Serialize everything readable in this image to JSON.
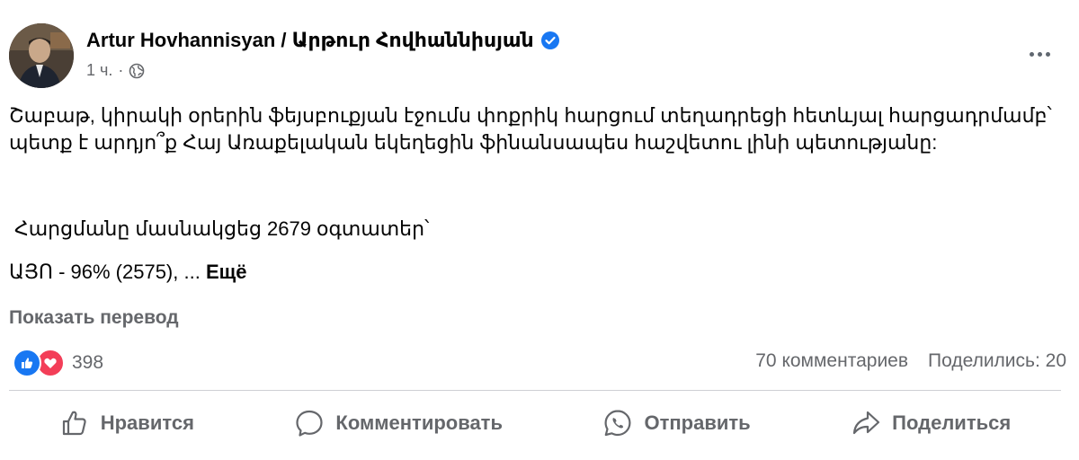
{
  "post": {
    "author": "Artur Hovhannisyan / Արթուր Հովհաննիսյան",
    "time": "1 ч.",
    "separator": "·",
    "paragraph1": "Շաբաթ, կիրակի օրերին ֆեյսբուքյան էջումս փոքրիկ հարցում տեղադրեցի հետևյալ հարցադրմամբ՝ պետք է արդյո՞ք Հայ Առաքելական եկեղեցին ֆինանսապես հաշվետու լինի պետությանը:",
    "paragraph2": "Հարցմանը մասնակցեց 2679 օգտատեր՝",
    "paragraph3": "ԱՅՈ - 96% (2575), ...",
    "see_more": "Ещё",
    "translate": "Показать перевод"
  },
  "stats": {
    "reactions_count": "398",
    "comments": "70 комментариев",
    "shares": "Поделились: 20"
  },
  "actions": {
    "like": "Нравится",
    "comment": "Комментировать",
    "send": "Отправить",
    "share": "Поделиться"
  },
  "colors": {
    "verified": "#1877f2",
    "like": "#1877f2",
    "love": "#f33e58",
    "secondary_text": "#65676b"
  },
  "icons": [
    "verified-badge-icon",
    "globe-icon",
    "more-icon",
    "like-reaction-icon",
    "love-reaction-icon",
    "thumbs-up-icon",
    "comment-icon",
    "whatsapp-icon",
    "share-icon"
  ]
}
